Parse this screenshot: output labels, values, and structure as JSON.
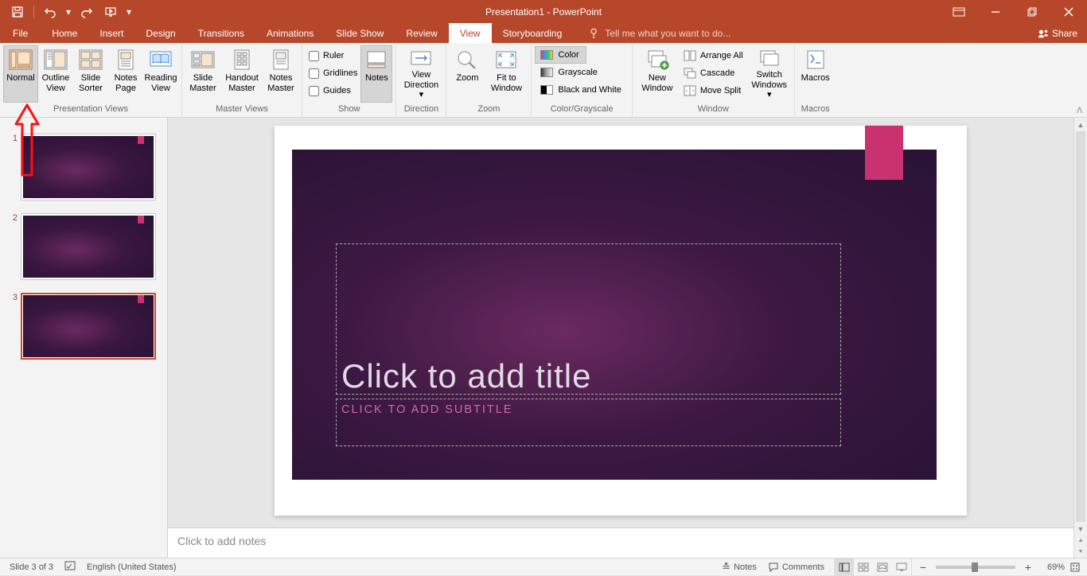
{
  "title": "Presentation1 - PowerPoint",
  "qat": {
    "saveTip": "Save",
    "undoTip": "Undo",
    "redoTip": "Redo",
    "startTip": "Start From Beginning"
  },
  "tabs": {
    "file": "File",
    "home": "Home",
    "insert": "Insert",
    "design": "Design",
    "transitions": "Transitions",
    "animations": "Animations",
    "slideshow": "Slide Show",
    "review": "Review",
    "view": "View",
    "storyboarding": "Storyboarding"
  },
  "tellMe": "Tell me what you want to do...",
  "share": "Share",
  "ribbon": {
    "presentationViews": {
      "group": "Presentation Views",
      "normal": "Normal",
      "outlineView": "Outline View",
      "slideSorter": "Slide Sorter",
      "notesPage": "Notes Page",
      "readingView": "Reading View"
    },
    "masterViews": {
      "group": "Master Views",
      "slideMaster": "Slide Master",
      "handoutMaster": "Handout Master",
      "notesMaster": "Notes Master"
    },
    "show": {
      "group": "Show",
      "ruler": "Ruler",
      "gridlines": "Gridlines",
      "guides": "Guides",
      "notes": "Notes"
    },
    "direction": {
      "group": "Direction",
      "viewDirection": "View Direction"
    },
    "zoom": {
      "group": "Zoom",
      "zoom": "Zoom",
      "fitToWindow": "Fit to Window"
    },
    "colorGrayscale": {
      "group": "Color/Grayscale",
      "color": "Color",
      "grayscale": "Grayscale",
      "blackAndWhite": "Black and White"
    },
    "window": {
      "group": "Window",
      "newWindow": "New Window",
      "arrangeAll": "Arrange All",
      "cascade": "Cascade",
      "moveSplit": "Move Split",
      "switchWindows": "Switch Windows"
    },
    "macros": {
      "group": "Macros",
      "macros": "Macros"
    }
  },
  "thumbnails": {
    "slide1": "1",
    "slide2": "2",
    "slide3": "3"
  },
  "slide": {
    "titlePlaceholder": "Click to add title",
    "subtitlePlaceholder": "CLICK TO ADD SUBTITLE"
  },
  "notesPlaceholder": "Click to add notes",
  "status": {
    "slideCount": "Slide 3 of 3",
    "language": "English (United States)",
    "notes": "Notes",
    "comments": "Comments",
    "zoomPct": "69%"
  }
}
